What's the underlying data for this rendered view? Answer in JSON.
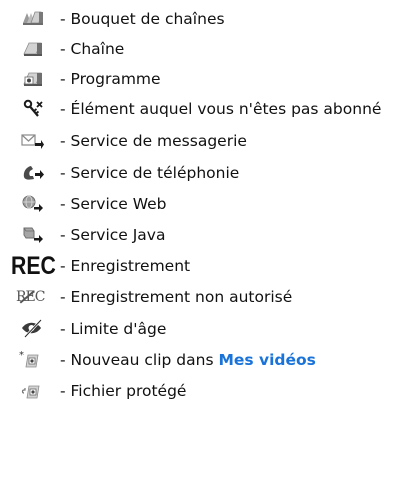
{
  "legend": {
    "rows": [
      {
        "icon": "channel-bundle-icon",
        "label": "- Bouquet de chaînes"
      },
      {
        "icon": "channel-icon",
        "label": "- Chaîne"
      },
      {
        "icon": "program-icon",
        "label": "- Programme"
      },
      {
        "icon": "not-subscribed-icon",
        "label": "- Élément auquel vous n'êtes pas abonné"
      },
      {
        "icon": "messaging-service-icon",
        "label": "- Service de messagerie"
      },
      {
        "icon": "telephony-service-icon",
        "label": "- Service de téléphonie"
      },
      {
        "icon": "web-service-icon",
        "label": "- Service Web"
      },
      {
        "icon": "java-service-icon",
        "label": "- Service Java"
      },
      {
        "icon": "recording-icon",
        "icon_text": "REC",
        "label": "- Enregistrement"
      },
      {
        "icon": "recording-not-allowed-icon",
        "icon_text": "REC",
        "label": "- Enregistrement non autorisé"
      },
      {
        "icon": "age-limit-icon",
        "label": "- Limite d'âge"
      },
      {
        "icon": "new-clip-icon",
        "label_prefix": "- Nouveau clip dans ",
        "label_link": "Mes vidéos"
      },
      {
        "icon": "protected-file-icon",
        "label": "- Fichier protégé"
      }
    ]
  },
  "colors": {
    "text": "#111111",
    "link": "#1a73d9",
    "icon_gray": "#8a8a8a",
    "icon_dark": "#222222"
  }
}
